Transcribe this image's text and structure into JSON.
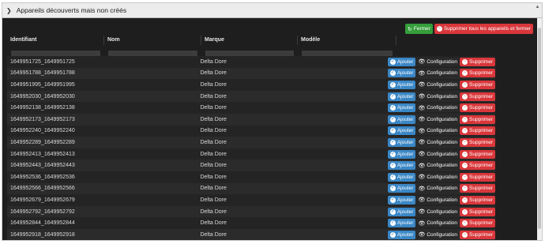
{
  "window": {
    "title": "Appareils découverts mais non créés"
  },
  "toolbar": {
    "close_label": "Fermer",
    "delete_all_label": "Supprimer tous les appareils et fermer"
  },
  "table": {
    "headers": [
      "Identifiant",
      "Nom",
      "Marque",
      "Modèle"
    ],
    "actions": {
      "add": "Ajouter",
      "config": "Configuration",
      "delete": "Supprimer"
    },
    "rows": [
      {
        "id": "1649951725_1649951725",
        "nom": "",
        "marque": "Delta Dore",
        "modele": ""
      },
      {
        "id": "1649951788_1649951788",
        "nom": "",
        "marque": "Delta Dore",
        "modele": ""
      },
      {
        "id": "1649951995_1649951995",
        "nom": "",
        "marque": "Delta Dore",
        "modele": ""
      },
      {
        "id": "1649952030_1649952030",
        "nom": "",
        "marque": "Delta Dore",
        "modele": ""
      },
      {
        "id": "1649952138_1649952138",
        "nom": "",
        "marque": "Delta Dore",
        "modele": ""
      },
      {
        "id": "1649952173_1649952173",
        "nom": "",
        "marque": "Delta Dore",
        "modele": ""
      },
      {
        "id": "1649952240_1649952240",
        "nom": "",
        "marque": "Delta Dore",
        "modele": ""
      },
      {
        "id": "1649952289_1649952289",
        "nom": "",
        "marque": "Delta Dore",
        "modele": ""
      },
      {
        "id": "1649952413_1649952413",
        "nom": "",
        "marque": "Delta Dore",
        "modele": ""
      },
      {
        "id": "1649952443_1649952443",
        "nom": "",
        "marque": "Delta Dore",
        "modele": ""
      },
      {
        "id": "1649952536_1649952536",
        "nom": "",
        "marque": "Delta Dore",
        "modele": ""
      },
      {
        "id": "1649952566_1649952566",
        "nom": "",
        "marque": "Delta Dore",
        "modele": ""
      },
      {
        "id": "1649952679_1649952679",
        "nom": "",
        "marque": "Delta Dore",
        "modele": ""
      },
      {
        "id": "1649952792_1649952792",
        "nom": "",
        "marque": "Delta Dore",
        "modele": ""
      },
      {
        "id": "1649952844_1649952844",
        "nom": "",
        "marque": "Delta Dore",
        "modele": ""
      },
      {
        "id": "1649952918_1649952918",
        "nom": "",
        "marque": "Delta Dore",
        "modele": ""
      }
    ]
  },
  "colors": {
    "add": "#3a87c6",
    "delete": "#d9373b",
    "close": "#359e3b",
    "background": "#1e1e1e"
  },
  "icons": [
    "chevron-right-icon",
    "refresh-icon",
    "minus-circle-icon",
    "check-circle-icon",
    "eye-icon"
  ]
}
